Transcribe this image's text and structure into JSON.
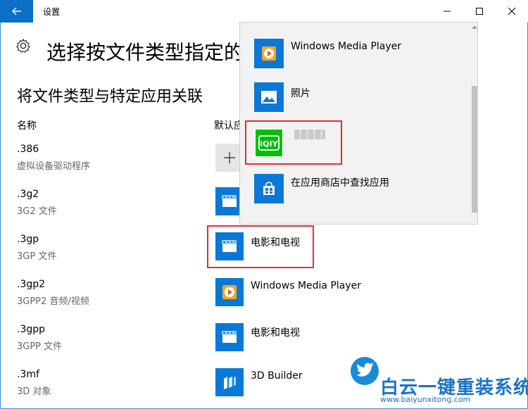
{
  "window": {
    "title": "设置"
  },
  "header": {
    "title": "选择按文件类型指定的",
    "settings_icon": "gear-icon"
  },
  "section": {
    "title": "将文件类型与特定应用关联"
  },
  "columns": {
    "name": "名称",
    "default_app": "默认应"
  },
  "rows": [
    {
      "ext": ".386",
      "desc": "虚拟设备驱动程序",
      "app": "",
      "icon": "plus-icon"
    },
    {
      "ext": ".3g2",
      "desc": "3G2 文件",
      "app": "",
      "icon": "movies-tv-icon"
    },
    {
      "ext": ".3gp",
      "desc": "3GP 文件",
      "app": "电影和电视",
      "icon": "movies-tv-icon"
    },
    {
      "ext": ".3gp2",
      "desc": "3GPP2 音频/视频",
      "app": "Windows Media Player",
      "icon": "media-player-icon"
    },
    {
      "ext": ".3gpp",
      "desc": "3GPP 文件",
      "app": "电影和电视",
      "icon": "movies-tv-icon"
    },
    {
      "ext": ".3mf",
      "desc": "3D 对象",
      "app": "3D Builder",
      "icon": "3d-builder-icon"
    }
  ],
  "popup": {
    "items": [
      {
        "label": "Windows Media Player",
        "icon": "media-player-icon"
      },
      {
        "label": "照片",
        "icon": "photos-icon"
      },
      {
        "label": "",
        "icon": "iqiyi-icon"
      },
      {
        "label": "在应用商店中查找应用",
        "icon": "store-icon"
      }
    ]
  },
  "watermark": {
    "title": "白云一键重装系统",
    "url": "www.baiyunxitong.com"
  },
  "colors": {
    "accent": "#0b78d7",
    "highlight": "#e0302f",
    "iqiyi": "#00be06"
  }
}
